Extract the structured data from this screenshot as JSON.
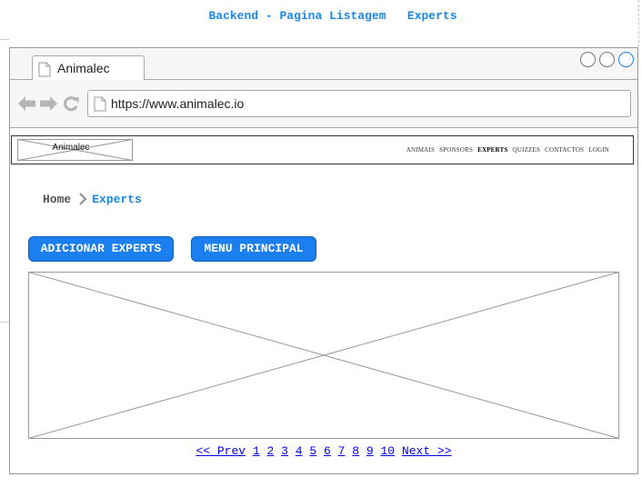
{
  "page_title": "Backend - Pagina Listagem   Experts",
  "browser": {
    "tab_label": "Animalec",
    "url": "https://www.animalec.io"
  },
  "site": {
    "logo_text": "Animalec",
    "menu": [
      {
        "label": "ANIMAIS",
        "active": false
      },
      {
        "label": "SPONSORS",
        "active": false
      },
      {
        "label": "EXPERTS",
        "active": true
      },
      {
        "label": "QUIZZES",
        "active": false
      },
      {
        "label": "CONTACTOS",
        "active": false
      },
      {
        "label": "LOGIN",
        "active": false
      }
    ]
  },
  "breadcrumb": {
    "home": "Home",
    "current": "Experts"
  },
  "buttons": {
    "add": "ADICIONAR EXPERTS",
    "menu": "MENU PRINCIPAL"
  },
  "pagination": {
    "prev": "<< Prev",
    "pages": [
      "1",
      "2",
      "3",
      "4",
      "5",
      "6",
      "7",
      "8",
      "9",
      "10"
    ],
    "next": "Next >>"
  },
  "colors": {
    "accent": "#1b87e6",
    "button": "#1b7ff0",
    "link": "#0000ee"
  },
  "icons": [
    "page-icon",
    "back-arrow-icon",
    "forward-arrow-icon",
    "reload-icon",
    "chevron-right-icon"
  ]
}
